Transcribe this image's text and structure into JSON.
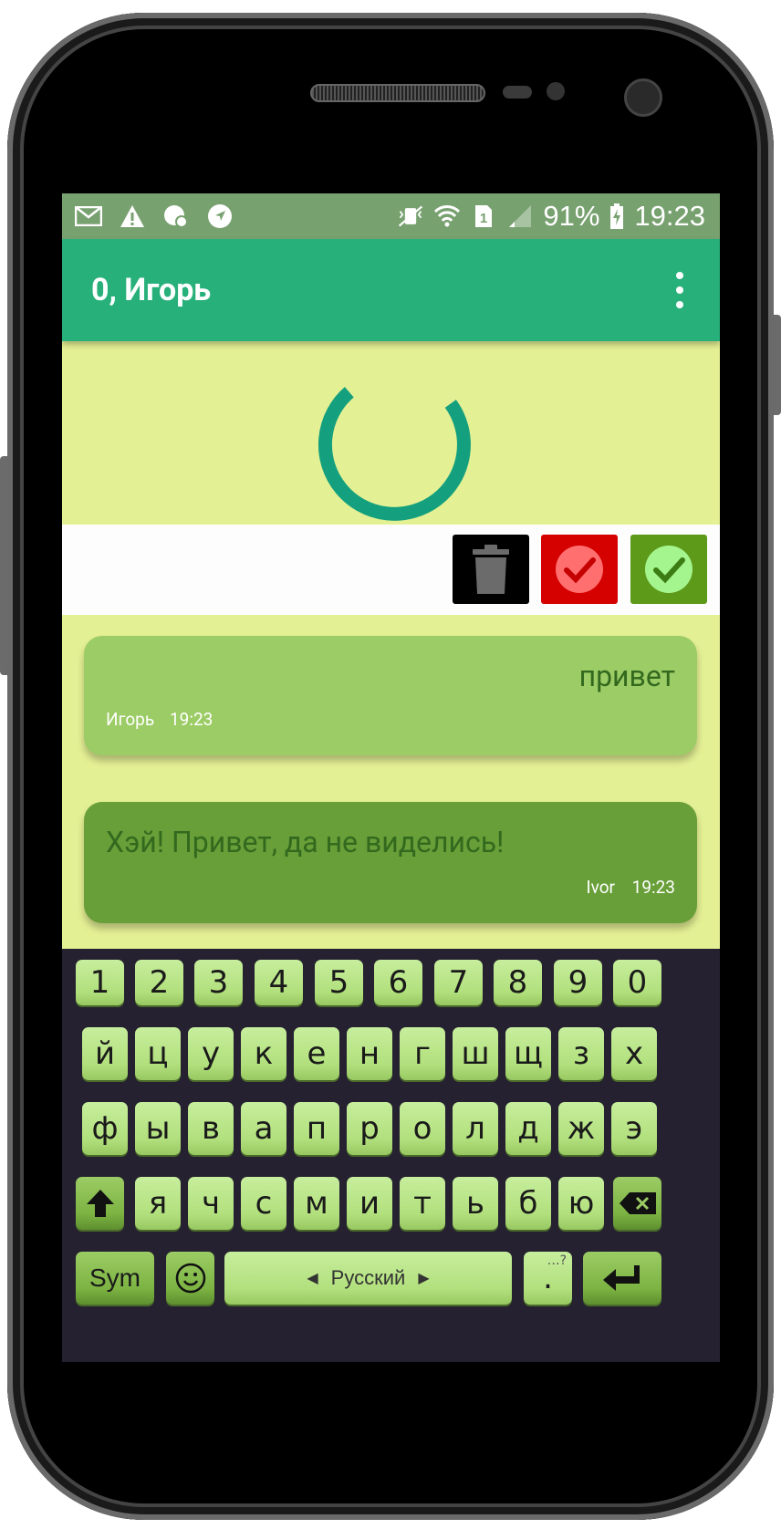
{
  "status_bar": {
    "left_icons": [
      "mail-icon",
      "warning-icon",
      "sync-icon",
      "navigation-icon"
    ],
    "right_icons": [
      "vibrate-icon",
      "wifi-icon",
      "sim-icon",
      "signal-icon"
    ],
    "battery": "91%",
    "time": "19:23"
  },
  "app_bar": {
    "title": "0, Игорь",
    "menu_icon": "overflow-menu-icon"
  },
  "action_row": {
    "buttons": [
      {
        "name": "delete",
        "icon": "trash-icon",
        "color": "#000000"
      },
      {
        "name": "reject",
        "icon": "check-red-icon",
        "color": "#d50000"
      },
      {
        "name": "accept",
        "icon": "check-green-icon",
        "color": "#5d9a1a"
      }
    ]
  },
  "messages": [
    {
      "text": "привет",
      "author": "Игорь",
      "time": "19:23",
      "color": "#9ccc65"
    },
    {
      "text": "Хэй! Привет, да не виделись!",
      "author": "Ivor",
      "time": "19:23",
      "color": "#689f38"
    }
  ],
  "keyboard": {
    "number_row": [
      "1",
      "2",
      "3",
      "4",
      "5",
      "6",
      "7",
      "8",
      "9",
      "0"
    ],
    "row1": [
      "й",
      "ц",
      "у",
      "к",
      "е",
      "н",
      "г",
      "ш",
      "щ",
      "з",
      "х"
    ],
    "row2": [
      "ф",
      "ы",
      "в",
      "а",
      "п",
      "р",
      "о",
      "л",
      "д",
      "ж",
      "э"
    ],
    "row3": [
      "я",
      "ч",
      "с",
      "м",
      "и",
      "т",
      "ь",
      "б",
      "ю"
    ],
    "sym_label": "Sym",
    "language_label": "Русский",
    "period_label": ".",
    "period_hint": "…?"
  },
  "colors": {
    "status_bar": "#78a170",
    "app_bar": "#27b07a",
    "background": "#e4f094",
    "spinner": "#14a07e",
    "keyboard_bg": "#252130"
  }
}
